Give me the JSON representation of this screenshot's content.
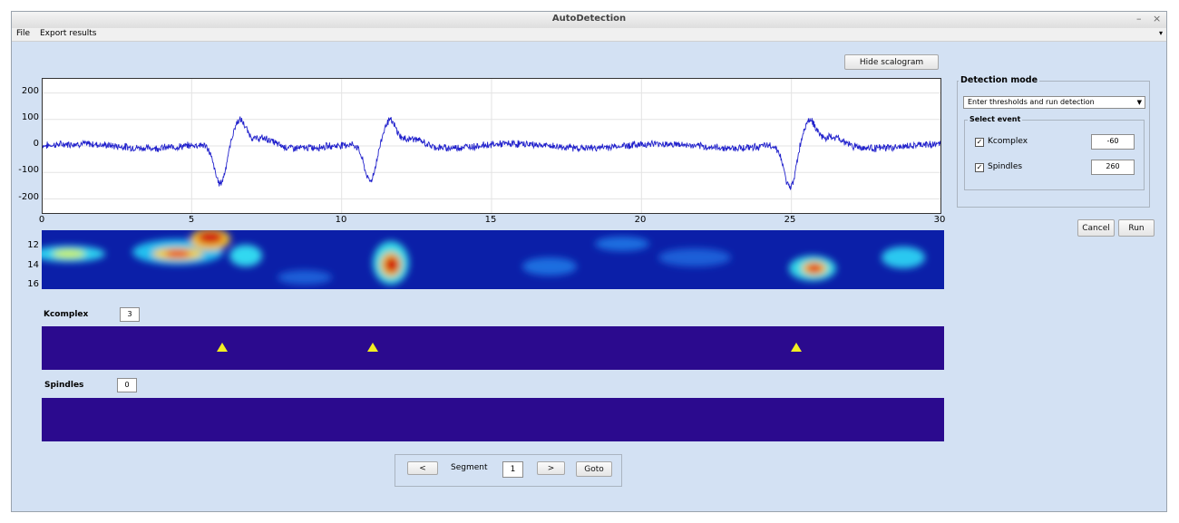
{
  "window": {
    "title": "AutoDetection",
    "minimize": "–",
    "close": "×"
  },
  "menu": {
    "file": "File",
    "export": "Export results",
    "overflow": "▾"
  },
  "buttons": {
    "hide_scalogram": "Hide scalogram",
    "cancel": "Cancel",
    "run": "Run",
    "prev": "<",
    "next": ">",
    "goto": "Goto"
  },
  "signal_plot": {
    "y_ticks": [
      "200",
      "100",
      "0",
      "-100",
      "-200"
    ],
    "x_ticks": [
      "0",
      "5",
      "10",
      "15",
      "20",
      "25",
      "30"
    ],
    "colors": {
      "line": "#2222cc",
      "grid": "#e3e3e3"
    }
  },
  "scalogram": {
    "y_ticks": [
      "12",
      "14",
      "16"
    ]
  },
  "detection_mode": {
    "title": "Detection mode",
    "selected_option": "Enter thresholds and run detection",
    "select_event_title": "Select event",
    "events": [
      {
        "label": "Kcomplex",
        "checked": true,
        "threshold": "-60"
      },
      {
        "label": "Spindles",
        "checked": true,
        "threshold": "260"
      }
    ]
  },
  "tracks": {
    "kcomplex": {
      "label": "Kcomplex",
      "count": "3",
      "events_s": [
        6,
        11,
        25.1
      ]
    },
    "spindles": {
      "label": "Spindles",
      "count": "0",
      "events_s": []
    },
    "colors": {
      "background": "#2b0a8e",
      "marker": "#f2ee22"
    }
  },
  "navigation": {
    "segment_label": "Segment",
    "segment_value": "1"
  }
}
